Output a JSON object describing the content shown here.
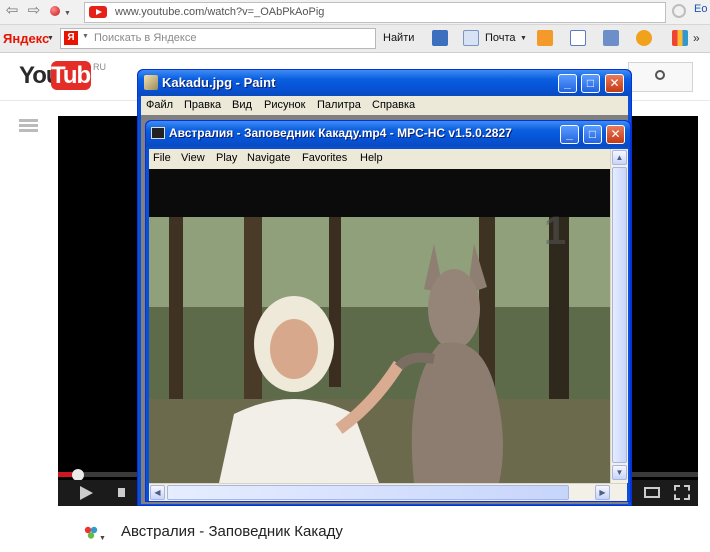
{
  "browser": {
    "url": "www.youtube.com/watch?v=_OAbPkAoPig",
    "corner_text": "Eo"
  },
  "yandex_toolbar": {
    "logo": "Яндекс",
    "search_placeholder": "Поискать в Яндексе",
    "find_label": "Найти",
    "mail_label": "Почта"
  },
  "youtube": {
    "logo_you": "You",
    "logo_tube": "Tube",
    "region": "RU",
    "video_title": "Австралия - Заповедник Какаду",
    "progress_fraction": 0.03
  },
  "paint": {
    "title": "Kakadu.jpg - Paint",
    "menu": [
      "Файл",
      "Правка",
      "Вид",
      "Рисунок",
      "Палитра",
      "Справка"
    ]
  },
  "mpc": {
    "title": "Австралия - Заповедник Какаду.mp4 - MPC-HC v1.5.0.2827",
    "menu": [
      "File",
      "View",
      "Play",
      "Navigate",
      "Favorites",
      "Help"
    ]
  },
  "colors": {
    "xp_title_blue": "#0a5fe0",
    "youtube_red": "#e52d27",
    "yandex_red": "#e61400"
  }
}
